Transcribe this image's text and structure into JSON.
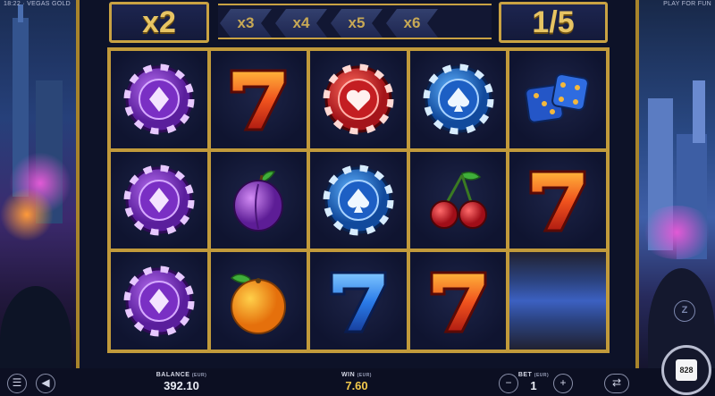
{
  "header": {
    "left_corner_text": "18:22 · VEGAS GOLD",
    "right_corner_text": "PLAY FOR FUN"
  },
  "multiplier": {
    "current": "x2",
    "upcoming": [
      "x3",
      "x4",
      "x5",
      "x6"
    ]
  },
  "free_spins": {
    "counter": "1/5"
  },
  "reels": [
    [
      "purple-diamond-chip",
      "orange-seven",
      "red-heart-chip",
      "blue-spade-chip",
      "blue-dice"
    ],
    [
      "purple-diamond-chip",
      "plum",
      "blue-spade-chip",
      "cherries",
      "orange-seven"
    ],
    [
      "purple-diamond-chip",
      "orange",
      "blue-seven",
      "orange-seven",
      "spinning-blur"
    ]
  ],
  "bottom_bar": {
    "balance_label": "BALANCE",
    "balance_currency": "(EUR)",
    "balance_value": "392.10",
    "win_label": "WIN",
    "win_currency": "(EUR)",
    "win_value": "7.60",
    "bet_label": "BET",
    "bet_currency": "(EUR)",
    "bet_value": "1",
    "minus": "−",
    "plus": "+",
    "spin_label": "828"
  },
  "badges": {
    "provider": "Z"
  },
  "colors": {
    "gold": "#c9a243",
    "frame": "#0d1228",
    "win": "#f2c94c"
  }
}
